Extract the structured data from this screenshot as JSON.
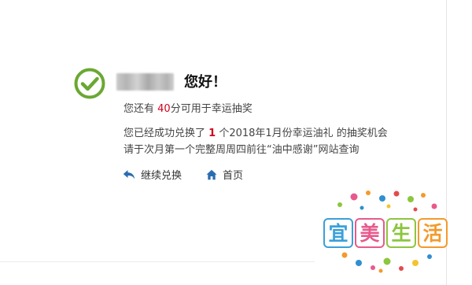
{
  "greeting": "您好！",
  "points": {
    "prefix": "您还有 ",
    "value": "40",
    "suffix": "分可用于幸运抽奖"
  },
  "message": {
    "line1_prefix": "您已经成功兑换了 ",
    "count": "1",
    "line1_suffix": " 个2018年1月份幸运油礼 的抽奖机会",
    "line2": "请于次月第一个完整周周四前往“油中感谢”网站查询"
  },
  "actions": {
    "continue_label": "继续兑换",
    "home_label": "首页"
  },
  "watermark": {
    "chars": [
      "宜",
      "美",
      "生",
      "活"
    ],
    "colors": [
      "#3aa0d8",
      "#e75a8c",
      "#8cc63e",
      "#f39a2b"
    ]
  },
  "colors": {
    "success": "#6aa832",
    "accent_red": "#d0021b",
    "link_icon": "#2b6cb0"
  },
  "icons": [
    "check-circle-icon",
    "reply-arrow-icon",
    "home-icon"
  ]
}
